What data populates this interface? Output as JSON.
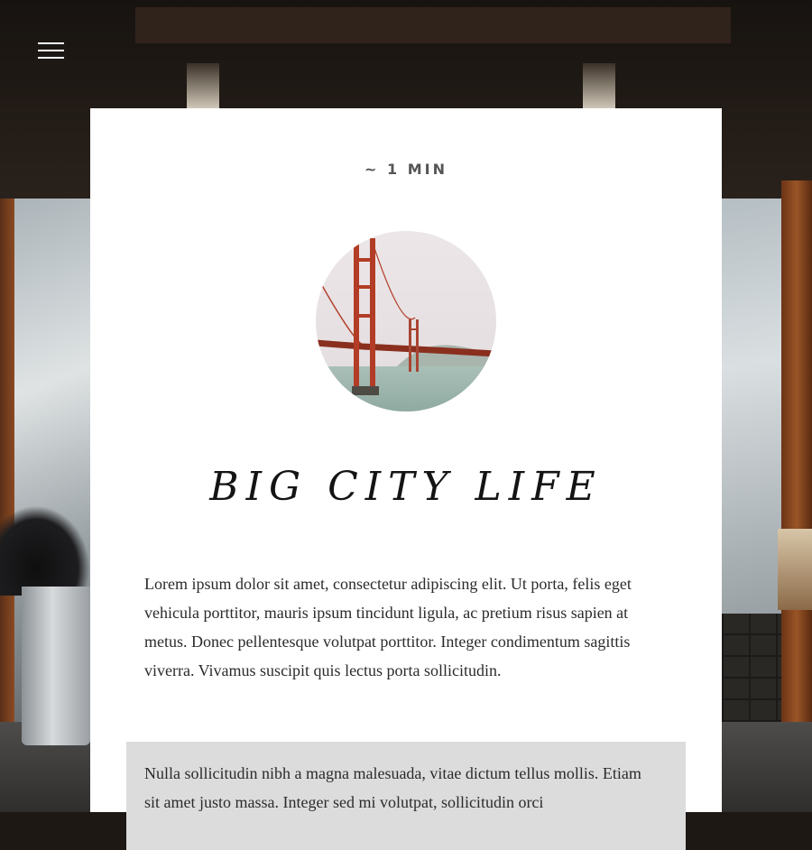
{
  "nav": {
    "menu_icon": "hamburger-menu-icon"
  },
  "article": {
    "read_time": "~ 1 MIN",
    "image_icon": "golden-gate-bridge-photo",
    "title": "BIG CITY LIFE",
    "paragraph_1": "Lorem ipsum dolor sit amet, consectetur adipiscing elit. Ut porta, felis eget vehicula porttitor, mauris ipsum tincidunt ligula, ac pretium risus sapien at metus. Donec pellentesque volutpat porttitor. Integer condimentum sagittis viverra. Vivamus suscipit quis lectus porta sollicitudin.",
    "paragraph_2": "Nulla sollicitudin nibh a magna malesuada, vitae dictum tellus mollis. Etiam sit amet justo massa. Integer sed mi volutpat, sollicitudin orci"
  },
  "colors": {
    "card_background": "#ffffff",
    "quote_background": "#dcdcdc",
    "text": "#2b2b2b",
    "meta_text": "#555555"
  }
}
